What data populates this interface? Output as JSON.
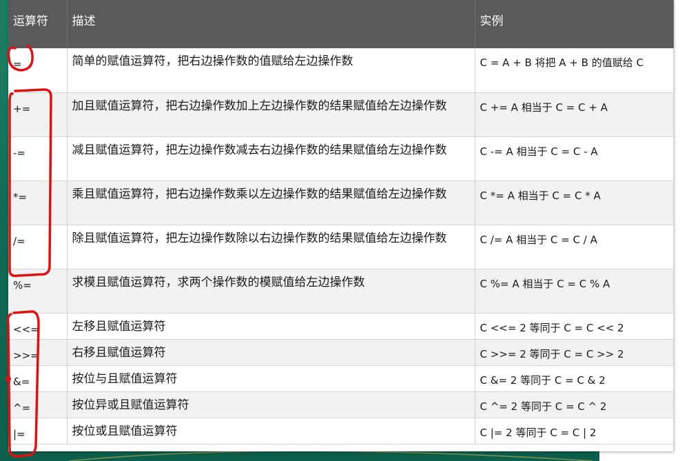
{
  "table": {
    "headers": {
      "operator": "运算符",
      "description": "描述",
      "example": "实例"
    },
    "rows": [
      {
        "op": "=",
        "desc": "简单的赋值运算符，把右边操作数的值赋给左边操作数",
        "example": "C = A + B 将把 A + B 的值赋给 C"
      },
      {
        "op": "+=",
        "desc": "加且赋值运算符，把右边操作数加上左边操作数的结果赋值给左边操作数",
        "example": "C += A 相当于 C = C + A"
      },
      {
        "op": "-=",
        "desc": "减且赋值运算符，把左边操作数减去右边操作数的结果赋值给左边操作数",
        "example": "C -= A 相当于 C = C - A"
      },
      {
        "op": "*=",
        "desc": "乘且赋值运算符，把右边操作数乘以左边操作数的结果赋值给左边操作数",
        "example": "C *= A 相当于 C = C * A"
      },
      {
        "op": "/=",
        "desc": "除且赋值运算符，把左边操作数除以右边操作数的结果赋值给左边操作数",
        "example": "C /= A 相当于 C = C / A"
      },
      {
        "op": "%=",
        "desc": "求模且赋值运算符，求两个操作数的模赋值给左边操作数",
        "example": "C %= A 相当于 C = C % A"
      },
      {
        "op": "<<=",
        "desc": "左移且赋值运算符",
        "example": "C <<= 2 等同于 C = C << 2"
      },
      {
        "op": ">>=",
        "desc": "右移且赋值运算符",
        "example": "C >>= 2 等同于 C = C >> 2"
      },
      {
        "op": "&=",
        "desc": "按位与且赋值运算符",
        "example": "C &= 2 等同于 C = C & 2"
      },
      {
        "op": "^=",
        "desc": "按位异或且赋值运算符",
        "example": "C ^= 2 等同于 C = C ^ 2"
      },
      {
        "op": "|=",
        "desc": "按位或且赋值运算符",
        "example": "C |= 2 等同于 C = C | 2"
      }
    ]
  },
  "colors": {
    "header_bg": "#5a5a5a",
    "annotation_red": "#e01010",
    "slide_bg": "#0e6b56"
  }
}
